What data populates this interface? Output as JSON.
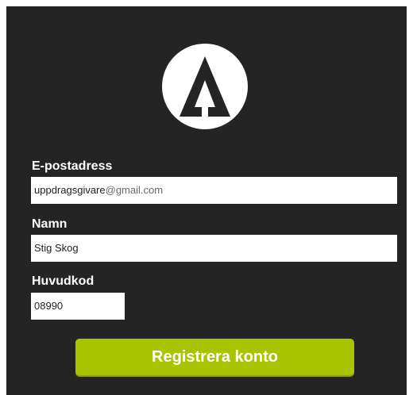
{
  "logo": {
    "icon": "a-frame-arrow-logo"
  },
  "form": {
    "email_label": "E-postadress",
    "email_user": "uppdragsgivare",
    "email_domain": "@gmail.com",
    "name_label": "Namn",
    "name_value": "Stig Skog",
    "code_label": "Huvudkod",
    "code_value": "08990",
    "submit_label": "Registrera konto"
  },
  "colors": {
    "panel_background": "#242424",
    "accent": "#a8c400",
    "text_light": "#ffffff"
  }
}
